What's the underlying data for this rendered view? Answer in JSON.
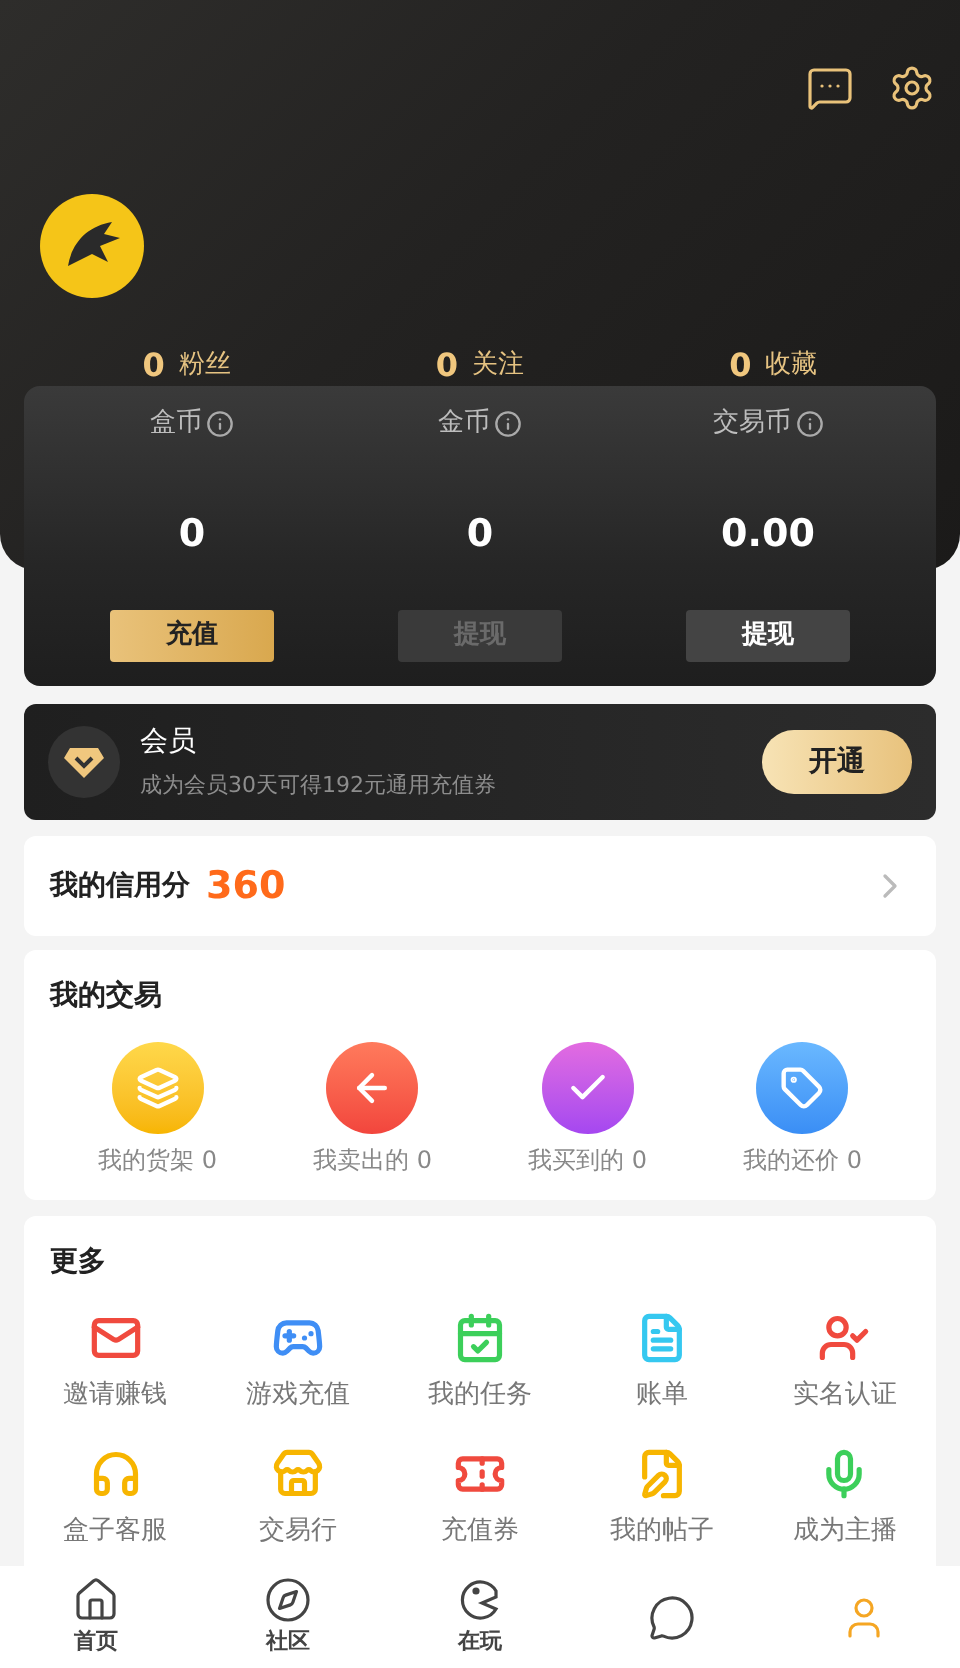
{
  "stats": [
    {
      "value": "0",
      "label": "粉丝"
    },
    {
      "value": "0",
      "label": "关注"
    },
    {
      "value": "0",
      "label": "收藏"
    }
  ],
  "wallet": [
    {
      "label": "盒币",
      "value": "0",
      "button": "充值",
      "kind": "primary"
    },
    {
      "label": "金币",
      "value": "0",
      "button": "提现",
      "kind": "disabled"
    },
    {
      "label": "交易币",
      "value": "0.00",
      "button": "提现",
      "kind": "normal"
    }
  ],
  "vip": {
    "title": "会员",
    "subtitle": "成为会员30天可得192元通用充值券",
    "button": "开通"
  },
  "credit": {
    "label": "我的信用分",
    "score": "360"
  },
  "trade": {
    "title": "我的交易",
    "items": [
      {
        "label": "我的货架 0",
        "kind": "shelf"
      },
      {
        "label": "我卖出的 0",
        "kind": "sold"
      },
      {
        "label": "我买到的 0",
        "kind": "bought"
      },
      {
        "label": "我的还价 0",
        "kind": "offer"
      }
    ]
  },
  "more": {
    "title": "更多",
    "items": [
      {
        "label": "邀请赚钱",
        "kind": "invite"
      },
      {
        "label": "游戏充值",
        "kind": "game"
      },
      {
        "label": "我的任务",
        "kind": "task"
      },
      {
        "label": "账单",
        "kind": "bill"
      },
      {
        "label": "实名认证",
        "kind": "verify"
      },
      {
        "label": "盒子客服",
        "kind": "service"
      },
      {
        "label": "交易行",
        "kind": "shop"
      },
      {
        "label": "充值券",
        "kind": "coupon"
      },
      {
        "label": "我的帖子",
        "kind": "post"
      },
      {
        "label": "成为主播",
        "kind": "anchor"
      }
    ]
  },
  "nav": [
    {
      "label": "首页",
      "kind": "home",
      "selected": false
    },
    {
      "label": "社区",
      "kind": "community",
      "selected": false
    },
    {
      "label": "在玩",
      "kind": "playing",
      "selected": false
    },
    {
      "kind": "message",
      "selected": false
    },
    {
      "kind": "profile",
      "selected": true
    }
  ]
}
